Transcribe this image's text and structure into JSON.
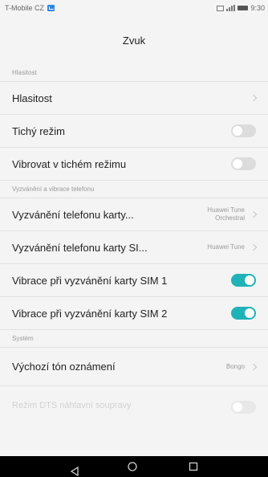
{
  "status": {
    "carrier": "T-Mobile CZ",
    "time": "9:30"
  },
  "header": {
    "title": "Zvuk"
  },
  "sections": {
    "volume": "Hlasitost",
    "ringing": "Vyzvánění a vibrace telefonu",
    "system": "Systém"
  },
  "rows": {
    "volume": {
      "label": "Hlasitost"
    },
    "silent": {
      "label": "Tichý režim",
      "enabled": false
    },
    "vibrate_silent": {
      "label": "Vibrovat v tichém režimu",
      "enabled": false
    },
    "ringtone_sim1": {
      "label": "Vyzvánění telefonu karty...",
      "value_line1": "Huawei Tune",
      "value_line2": "Orchestral"
    },
    "ringtone_sim2": {
      "label": "Vyzvánění telefonu karty SI...",
      "value": "Huawei Tune"
    },
    "vibrate_sim1": {
      "label": "Vibrace při vyzvánění karty SIM 1",
      "enabled": true
    },
    "vibrate_sim2": {
      "label": "Vibrace při vyzvánění karty SIM 2",
      "enabled": true
    },
    "notification_tone": {
      "label": "Výchozí tón oznámení",
      "value": "Bongo"
    },
    "dts": {
      "label": "Režim DTS náhlavní soupravy"
    }
  },
  "colors": {
    "accent": "#1fb3b8",
    "toggle_off": "#dcdcdc",
    "background": "#f4f4f4",
    "navbar": "#000000"
  },
  "icons": [
    "message-icon",
    "sim-icon",
    "signal-icon",
    "battery-icon",
    "chevron-right-icon",
    "back-icon",
    "home-icon",
    "recent-apps-icon"
  ]
}
